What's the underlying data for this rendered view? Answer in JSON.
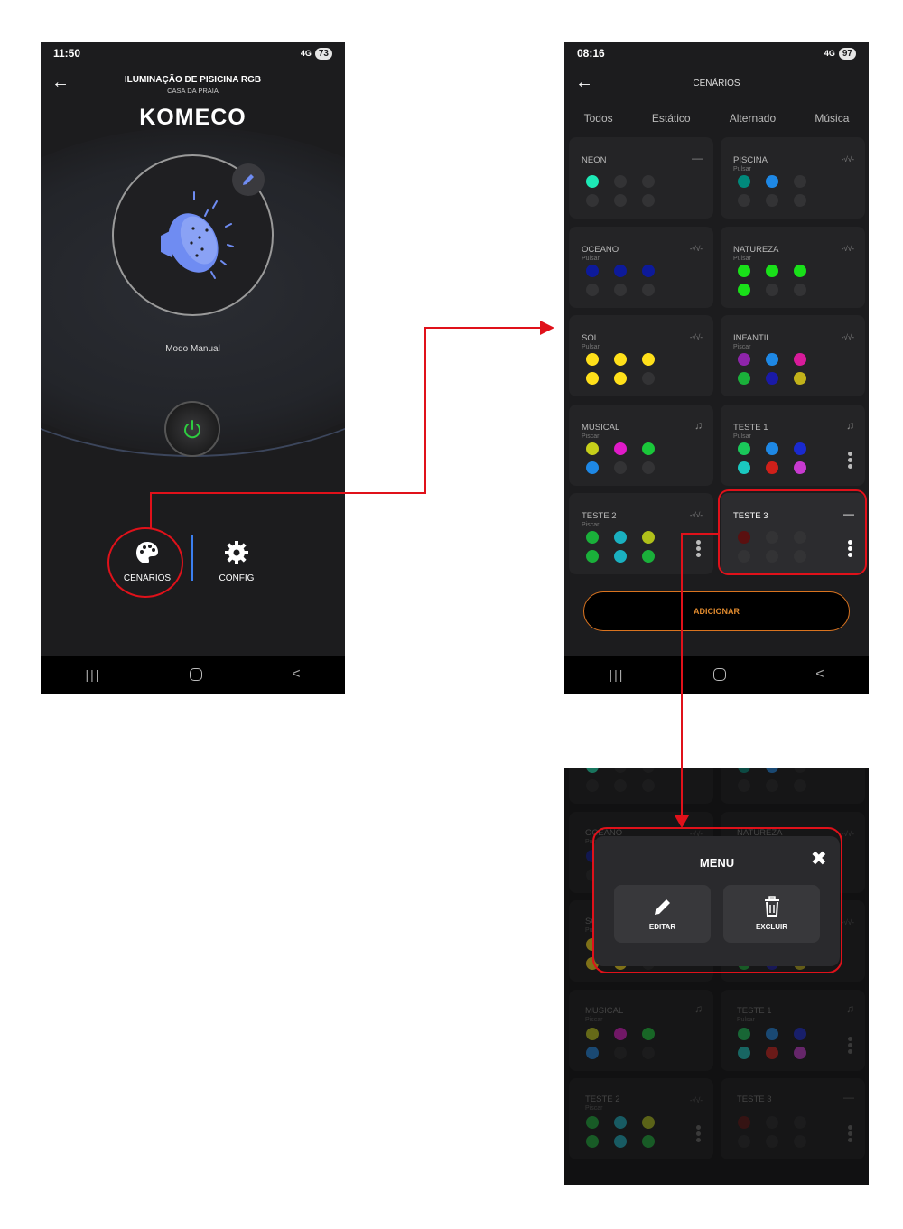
{
  "phone1": {
    "status_time": "11:50",
    "status_signal": "4G",
    "battery": "73",
    "title": "ILUMINAÇÃO DE PISICINA RGB",
    "subtitle": "CASA DA PRAIA",
    "logo": "KOMECO",
    "mode": "Modo Manual",
    "actions": [
      {
        "label": "CENÁRIOS",
        "icon": "palette-icon"
      },
      {
        "label": "CONFIG",
        "icon": "gear-icon"
      }
    ]
  },
  "phone2": {
    "status_time": "08:16",
    "status_signal": "4G",
    "battery": "97",
    "title": "CENÁRIOS",
    "tabs": [
      "Todos",
      "Estático",
      "Alternado",
      "Música"
    ],
    "add_label": "ADICIONAR",
    "scenarios": [
      {
        "name": "NEON",
        "mode": "",
        "icon": "minus-icon",
        "colors": [
          "#1de9b6"
        ]
      },
      {
        "name": "PISCINA",
        "mode": "Pulsar",
        "icon": "pulse-icon",
        "colors": [
          "#00897b",
          "#1e88e5"
        ]
      },
      {
        "name": "OCEANO",
        "mode": "Pulsar",
        "icon": "pulse-icon",
        "colors": [
          "#0d1a9a",
          "#0d1a9a",
          "#0d1a9a"
        ]
      },
      {
        "name": "NATUREZA",
        "mode": "Pulsar",
        "icon": "pulse-icon",
        "colors": [
          "#19e019",
          "#19e019",
          "#19e019",
          "#19e019"
        ]
      },
      {
        "name": "SOL",
        "mode": "Pulsar",
        "icon": "pulse-icon",
        "colors": [
          "#ffe01a",
          "#ffe01a",
          "#ffe01a",
          "#ffe01a",
          "#ffe01a"
        ]
      },
      {
        "name": "INFANTIL",
        "mode": "Piscar",
        "icon": "pulse-icon",
        "colors": [
          "#8e24aa",
          "#1e88e5",
          "#d81b9a",
          "#1ab03a",
          "#1a1aa8",
          "#c2b21a"
        ]
      },
      {
        "name": "MUSICAL",
        "mode": "Piscar",
        "icon": "music-icon",
        "colors": [
          "#c6cf1a",
          "#e01ac8",
          "#1ac83a",
          "#1e88e5"
        ]
      },
      {
        "name": "TESTE 1",
        "mode": "Pulsar",
        "icon": "music-icon",
        "colors": [
          "#1ac85a",
          "#1e88e5",
          "#1a2ad0",
          "#1ac8c0",
          "#d0201a",
          "#c83ad0"
        ]
      },
      {
        "name": "TESTE 2",
        "mode": "Piscar",
        "icon": "pulse-icon",
        "colors": [
          "#1ab03a",
          "#1ab0c0",
          "#b0c01a",
          "#1ab03a",
          "#1ab0c0",
          "#1ab03a"
        ]
      },
      {
        "name": "TESTE 3",
        "mode": "",
        "icon": "minus-icon",
        "colors": [
          "#5a1010"
        ]
      }
    ]
  },
  "phone3": {
    "menu_title": "MENU",
    "edit_label": "EDITAR",
    "delete_label": "EXCLUIR",
    "background_labels": [
      "OCEANO",
      "NATUREZA",
      "MUSICAL",
      "TESTE 1",
      "TESTE 2",
      "TESTE 3",
      "Piscar",
      "Pulsar"
    ]
  },
  "colors": {
    "accent_red": "#e0111a",
    "accent_orange": "#d9731f",
    "power_green": "#2ecc40",
    "lamp_blue": "#6f8cf2"
  }
}
